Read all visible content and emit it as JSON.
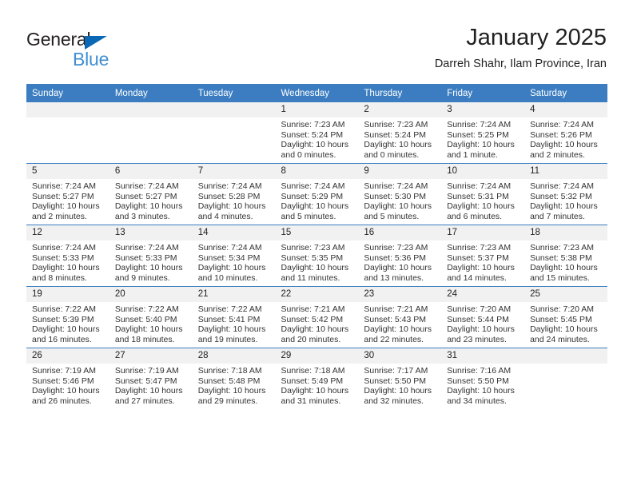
{
  "brand": {
    "name_part1": "General",
    "name_part2": "Blue",
    "triangle_color": "#0a68b4",
    "blue_text_color": "#3f8fd2"
  },
  "header": {
    "title": "January 2025",
    "subtitle": "Darreh Shahr, Ilam Province, Iran",
    "header_bg_color": "#3b7dc0",
    "daynum_bg_color": "#f1f1f1"
  },
  "weekdays": [
    "Sunday",
    "Monday",
    "Tuesday",
    "Wednesday",
    "Thursday",
    "Friday",
    "Saturday"
  ],
  "weeks": [
    [
      {
        "day": "",
        "empty": true,
        "sunrise": "",
        "sunset": "",
        "daylight1": "",
        "daylight2": ""
      },
      {
        "day": "",
        "empty": true,
        "sunrise": "",
        "sunset": "",
        "daylight1": "",
        "daylight2": ""
      },
      {
        "day": "",
        "empty": true,
        "sunrise": "",
        "sunset": "",
        "daylight1": "",
        "daylight2": ""
      },
      {
        "day": "1",
        "sunrise": "Sunrise: 7:23 AM",
        "sunset": "Sunset: 5:24 PM",
        "daylight1": "Daylight: 10 hours",
        "daylight2": "and 0 minutes."
      },
      {
        "day": "2",
        "sunrise": "Sunrise: 7:23 AM",
        "sunset": "Sunset: 5:24 PM",
        "daylight1": "Daylight: 10 hours",
        "daylight2": "and 0 minutes."
      },
      {
        "day": "3",
        "sunrise": "Sunrise: 7:24 AM",
        "sunset": "Sunset: 5:25 PM",
        "daylight1": "Daylight: 10 hours",
        "daylight2": "and 1 minute."
      },
      {
        "day": "4",
        "sunrise": "Sunrise: 7:24 AM",
        "sunset": "Sunset: 5:26 PM",
        "daylight1": "Daylight: 10 hours",
        "daylight2": "and 2 minutes."
      }
    ],
    [
      {
        "day": "5",
        "sunrise": "Sunrise: 7:24 AM",
        "sunset": "Sunset: 5:27 PM",
        "daylight1": "Daylight: 10 hours",
        "daylight2": "and 2 minutes."
      },
      {
        "day": "6",
        "sunrise": "Sunrise: 7:24 AM",
        "sunset": "Sunset: 5:27 PM",
        "daylight1": "Daylight: 10 hours",
        "daylight2": "and 3 minutes."
      },
      {
        "day": "7",
        "sunrise": "Sunrise: 7:24 AM",
        "sunset": "Sunset: 5:28 PM",
        "daylight1": "Daylight: 10 hours",
        "daylight2": "and 4 minutes."
      },
      {
        "day": "8",
        "sunrise": "Sunrise: 7:24 AM",
        "sunset": "Sunset: 5:29 PM",
        "daylight1": "Daylight: 10 hours",
        "daylight2": "and 5 minutes."
      },
      {
        "day": "9",
        "sunrise": "Sunrise: 7:24 AM",
        "sunset": "Sunset: 5:30 PM",
        "daylight1": "Daylight: 10 hours",
        "daylight2": "and 5 minutes."
      },
      {
        "day": "10",
        "sunrise": "Sunrise: 7:24 AM",
        "sunset": "Sunset: 5:31 PM",
        "daylight1": "Daylight: 10 hours",
        "daylight2": "and 6 minutes."
      },
      {
        "day": "11",
        "sunrise": "Sunrise: 7:24 AM",
        "sunset": "Sunset: 5:32 PM",
        "daylight1": "Daylight: 10 hours",
        "daylight2": "and 7 minutes."
      }
    ],
    [
      {
        "day": "12",
        "sunrise": "Sunrise: 7:24 AM",
        "sunset": "Sunset: 5:33 PM",
        "daylight1": "Daylight: 10 hours",
        "daylight2": "and 8 minutes."
      },
      {
        "day": "13",
        "sunrise": "Sunrise: 7:24 AM",
        "sunset": "Sunset: 5:33 PM",
        "daylight1": "Daylight: 10 hours",
        "daylight2": "and 9 minutes."
      },
      {
        "day": "14",
        "sunrise": "Sunrise: 7:24 AM",
        "sunset": "Sunset: 5:34 PM",
        "daylight1": "Daylight: 10 hours",
        "daylight2": "and 10 minutes."
      },
      {
        "day": "15",
        "sunrise": "Sunrise: 7:23 AM",
        "sunset": "Sunset: 5:35 PM",
        "daylight1": "Daylight: 10 hours",
        "daylight2": "and 11 minutes."
      },
      {
        "day": "16",
        "sunrise": "Sunrise: 7:23 AM",
        "sunset": "Sunset: 5:36 PM",
        "daylight1": "Daylight: 10 hours",
        "daylight2": "and 13 minutes."
      },
      {
        "day": "17",
        "sunrise": "Sunrise: 7:23 AM",
        "sunset": "Sunset: 5:37 PM",
        "daylight1": "Daylight: 10 hours",
        "daylight2": "and 14 minutes."
      },
      {
        "day": "18",
        "sunrise": "Sunrise: 7:23 AM",
        "sunset": "Sunset: 5:38 PM",
        "daylight1": "Daylight: 10 hours",
        "daylight2": "and 15 minutes."
      }
    ],
    [
      {
        "day": "19",
        "sunrise": "Sunrise: 7:22 AM",
        "sunset": "Sunset: 5:39 PM",
        "daylight1": "Daylight: 10 hours",
        "daylight2": "and 16 minutes."
      },
      {
        "day": "20",
        "sunrise": "Sunrise: 7:22 AM",
        "sunset": "Sunset: 5:40 PM",
        "daylight1": "Daylight: 10 hours",
        "daylight2": "and 18 minutes."
      },
      {
        "day": "21",
        "sunrise": "Sunrise: 7:22 AM",
        "sunset": "Sunset: 5:41 PM",
        "daylight1": "Daylight: 10 hours",
        "daylight2": "and 19 minutes."
      },
      {
        "day": "22",
        "sunrise": "Sunrise: 7:21 AM",
        "sunset": "Sunset: 5:42 PM",
        "daylight1": "Daylight: 10 hours",
        "daylight2": "and 20 minutes."
      },
      {
        "day": "23",
        "sunrise": "Sunrise: 7:21 AM",
        "sunset": "Sunset: 5:43 PM",
        "daylight1": "Daylight: 10 hours",
        "daylight2": "and 22 minutes."
      },
      {
        "day": "24",
        "sunrise": "Sunrise: 7:20 AM",
        "sunset": "Sunset: 5:44 PM",
        "daylight1": "Daylight: 10 hours",
        "daylight2": "and 23 minutes."
      },
      {
        "day": "25",
        "sunrise": "Sunrise: 7:20 AM",
        "sunset": "Sunset: 5:45 PM",
        "daylight1": "Daylight: 10 hours",
        "daylight2": "and 24 minutes."
      }
    ],
    [
      {
        "day": "26",
        "sunrise": "Sunrise: 7:19 AM",
        "sunset": "Sunset: 5:46 PM",
        "daylight1": "Daylight: 10 hours",
        "daylight2": "and 26 minutes."
      },
      {
        "day": "27",
        "sunrise": "Sunrise: 7:19 AM",
        "sunset": "Sunset: 5:47 PM",
        "daylight1": "Daylight: 10 hours",
        "daylight2": "and 27 minutes."
      },
      {
        "day": "28",
        "sunrise": "Sunrise: 7:18 AM",
        "sunset": "Sunset: 5:48 PM",
        "daylight1": "Daylight: 10 hours",
        "daylight2": "and 29 minutes."
      },
      {
        "day": "29",
        "sunrise": "Sunrise: 7:18 AM",
        "sunset": "Sunset: 5:49 PM",
        "daylight1": "Daylight: 10 hours",
        "daylight2": "and 31 minutes."
      },
      {
        "day": "30",
        "sunrise": "Sunrise: 7:17 AM",
        "sunset": "Sunset: 5:50 PM",
        "daylight1": "Daylight: 10 hours",
        "daylight2": "and 32 minutes."
      },
      {
        "day": "31",
        "sunrise": "Sunrise: 7:16 AM",
        "sunset": "Sunset: 5:50 PM",
        "daylight1": "Daylight: 10 hours",
        "daylight2": "and 34 minutes."
      },
      {
        "day": "",
        "empty": true,
        "sunrise": "",
        "sunset": "",
        "daylight1": "",
        "daylight2": ""
      }
    ]
  ]
}
